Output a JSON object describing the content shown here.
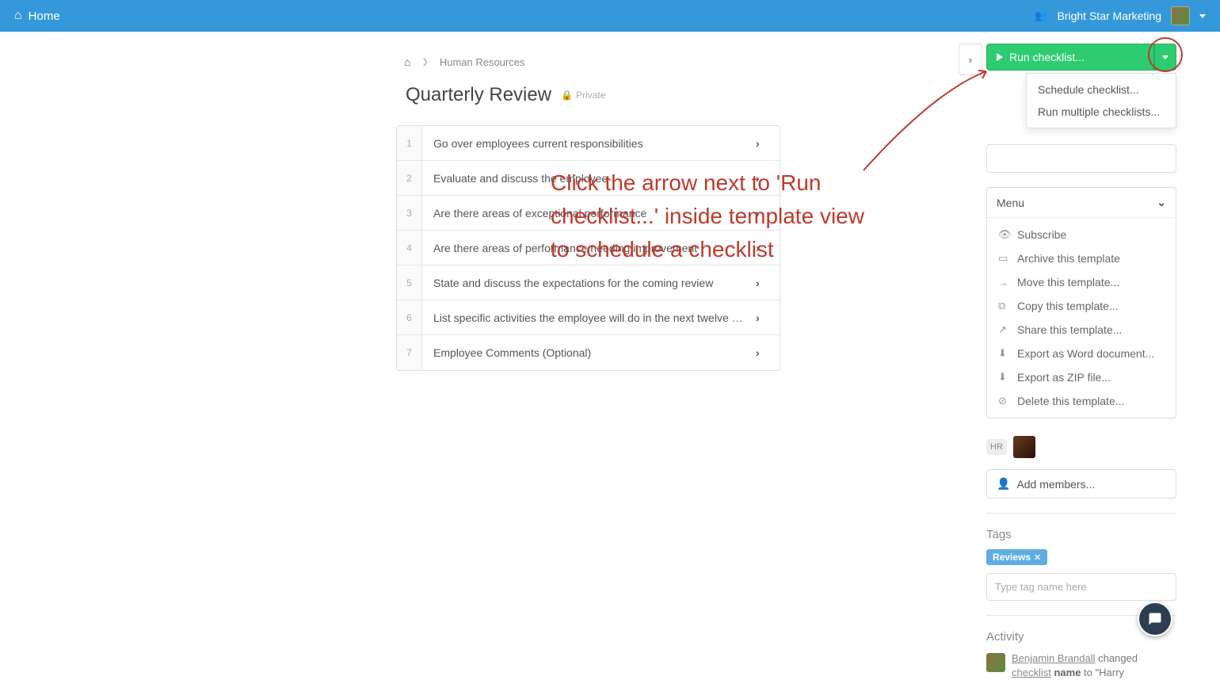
{
  "topbar": {
    "home": "Home",
    "org": "Bright Star Marketing"
  },
  "breadcrumb": {
    "folder": "Human Resources"
  },
  "page": {
    "title": "Quarterly Review",
    "privacy": "Private"
  },
  "rows": [
    "Go over employees current responsibilities",
    "Evaluate and discuss the employee",
    "Are there areas of exceptional performance",
    "Are there areas of performance needing improvement",
    "State and discuss the expectations for the coming review",
    "List specific activities the employee will do in the next twelve months",
    "Employee Comments (Optional)"
  ],
  "run": {
    "label": "Run checklist...",
    "dd_items": [
      "Schedule checklist...",
      "Run multiple checklists..."
    ]
  },
  "menu": {
    "header": "Menu",
    "items": [
      "Subscribe",
      "Archive this template",
      "Move this template...",
      "Copy this template...",
      "Share this template...",
      "Export as Word document...",
      "Export as ZIP file...",
      "Delete this template..."
    ]
  },
  "members": {
    "badge": "HR",
    "add": "Add members..."
  },
  "tags": {
    "label": "Tags",
    "tag": "Reviews",
    "placeholder": "Type tag name here"
  },
  "activity": {
    "label": "Activity",
    "user": "Benjamin Brandall",
    "verb": " changed ",
    "obj": "checklist",
    "field": " name",
    "rest": " to \"Harry"
  },
  "annotation": "Click the arrow next to 'Run checklist...' inside template view to schedule a checklist"
}
